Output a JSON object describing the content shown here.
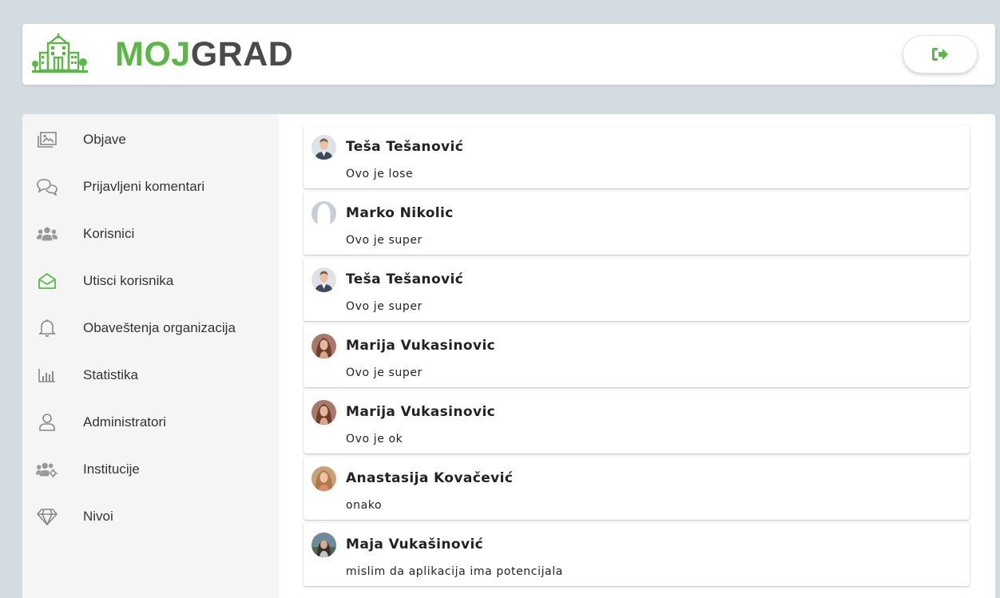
{
  "header": {
    "brand_part1": "MOJ",
    "brand_part2": "GRAD",
    "logout_icon": "sign-out-icon"
  },
  "colors": {
    "brand_green": "#5cb846",
    "brand_dark": "#4a4a4a",
    "page_bg": "#d3dce1",
    "sidebar_bg": "#f5f5f5"
  },
  "sidebar": {
    "items": [
      {
        "label": "Objave",
        "icon": "images-icon"
      },
      {
        "label": "Prijavljeni komentari",
        "icon": "comments-icon"
      },
      {
        "label": "Korisnici",
        "icon": "users-icon"
      },
      {
        "label": "Utisci korisnika",
        "icon": "envelope-open-icon",
        "active": true
      },
      {
        "label": "Obaveštenja organizacija",
        "icon": "bell-icon"
      },
      {
        "label": "Statistika",
        "icon": "bar-chart-icon"
      },
      {
        "label": "Administratori",
        "icon": "user-icon"
      },
      {
        "label": "Institucije",
        "icon": "users-gear-icon"
      },
      {
        "label": "Nivoi",
        "icon": "diamond-icon"
      }
    ]
  },
  "feedback": [
    {
      "name": "Teša Tešanović",
      "comment": "Ovo je lose",
      "avatar": "man-suit-avatar"
    },
    {
      "name": "Marko Nikolic",
      "comment": "Ovo je super",
      "avatar": "default-avatar"
    },
    {
      "name": "Teša Tešanović",
      "comment": "Ovo je super",
      "avatar": "man-suit-avatar"
    },
    {
      "name": "Marija Vukasinovic",
      "comment": "Ovo je super",
      "avatar": "woman-avatar"
    },
    {
      "name": "Marija Vukasinovic",
      "comment": "Ovo je ok",
      "avatar": "woman-avatar"
    },
    {
      "name": "Anastasija Kovačević",
      "comment": "onako",
      "avatar": "woman-blonde-avatar"
    },
    {
      "name": "Maja Vukašinović",
      "comment": "mislim da aplikacija ima potencijala",
      "avatar": "woman-outdoor-avatar"
    }
  ]
}
